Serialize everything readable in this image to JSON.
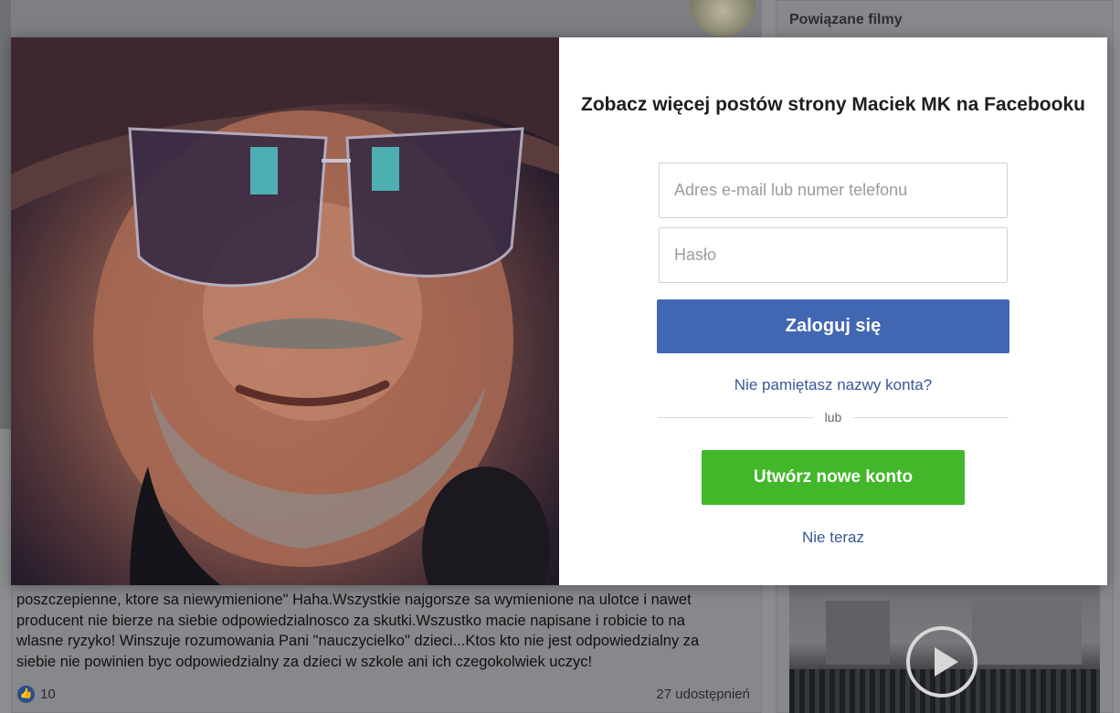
{
  "background": {
    "related_title": "Powiązane filmy",
    "post_lines": [
      "poszczepienne, ktore sa niewymienione\" Haha.Wszystkie najgorsze sa wymienione na ulotce i nawet",
      "producent nie bierze na siebie odpowiedzialnosco za skutki.Wszustko macie napisane i robicie to na",
      "wlasne ryzyko! Winszuje rozumowania Pani \"nauczycielko\" dzieci...Ktos kto nie jest odpowiedzialny za",
      "siebie nie powinien byc odpowiedzialny za dzieci w szkole ani ich czegokolwiek uczyc!"
    ],
    "like_count": "10",
    "shares": "27 udostępnień"
  },
  "modal": {
    "title": "Zobacz więcej postów strony Maciek MK na Facebooku",
    "email_placeholder": "Adres e-mail lub numer telefonu",
    "password_placeholder": "Hasło",
    "login_label": "Zaloguj się",
    "forgot_label": "Nie pamiętasz nazwy konta?",
    "divider_text": "lub",
    "create_label": "Utwórz nowe konto",
    "not_now_label": "Nie teraz"
  },
  "colors": {
    "login_button": "#4267b2",
    "create_button": "#42b72a",
    "link": "#385898"
  }
}
